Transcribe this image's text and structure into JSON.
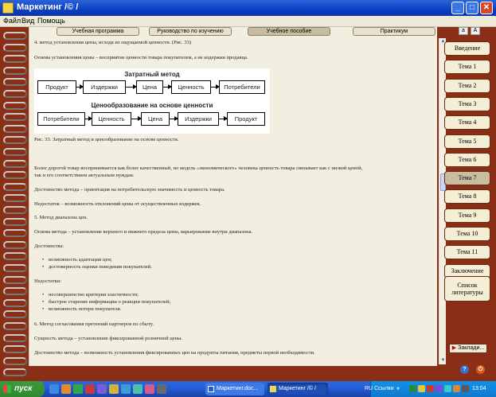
{
  "window": {
    "title": "Маркетинг /© /"
  },
  "menu": {
    "file": "Файл",
    "view": "Вид",
    "help": "Помощь"
  },
  "tabs": [
    "Учебная программа",
    "Руководство по изучению",
    "Учебное пособие",
    "Практикум"
  ],
  "font_buttons": {
    "small": "a",
    "large": "A"
  },
  "content": {
    "p1": "4. метод установления цены, исходя из ощущаемой ценности. (Рис. 33)",
    "p2": "Основа установления цены – восприятие ценности товара покупателем, а не издержки продавца.",
    "diagram": {
      "title1": "Затратный метод",
      "row1": [
        "Продукт",
        "Издержки",
        "Цена",
        "Ценность",
        "Потребители"
      ],
      "title2": "Ценообразование на основе ценности",
      "row2": [
        "Потребители",
        "Ценность",
        "Цена",
        "Издержки",
        "Продукт"
      ]
    },
    "caption": "Рис. 33. Затратный метод и ценообразование на основе ценности.",
    "p3a": "Более дорогой товар воспринимается как более качественный, но модель «экономического» человека ценность товара связывает как с низкой ценой,",
    "p3b": "так и его соответствием актуальным нуждам.",
    "p4": "Достоинство метода – ориентация на потребительскую значимость и ценность товара.",
    "p5": "Недостаток – возможность отклонений цены от осуществленных издержек.",
    "p6": "5. Метод диапазона цен.",
    "p7": "Основа метода – установление верхнего и нижнего предела цены, варьирование внутри диапазона.",
    "p8": "Достоинства:",
    "adv": [
      "возможность адаптации цен;",
      "достоверность оценки поведения покупателей."
    ],
    "p9": "Недостатки:",
    "dis": [
      "несовершенство критерия эластичности;",
      "быстрое старение информации о реакции покупателей;",
      "возможность потери покупателя."
    ],
    "p10": "6. Метод согласования претензий партнеров по сбыту.",
    "p11": "Сущность метода – установление фиксированной розничной цены.",
    "p12": "Достоинство метода – возможность установления фиксированных цен на продукты питания, предметы первой необходимости."
  },
  "nav": [
    "Введение",
    "Тема 1",
    "Тема 2",
    "Тема 3",
    "Тема 4",
    "Тема 5",
    "Тема 6",
    "Тема 7",
    "Тема 8",
    "Тема 9",
    "Тема 10",
    "Тема 11",
    "Заключение"
  ],
  "nav_active": "Тема 7",
  "nav_bibliography": [
    "Список",
    "литературы"
  ],
  "bookmark": "Заклади...",
  "taskbar": {
    "start": "пуск",
    "task1": "Маркетинг.doc...",
    "task2": "Маркетинг /© /",
    "search": "Ссылки",
    "lang": "RU",
    "clock": "13:04"
  },
  "colors": {
    "accent": "#8b2e16",
    "page": "#f3efe0",
    "taskbar": "#245edb"
  }
}
